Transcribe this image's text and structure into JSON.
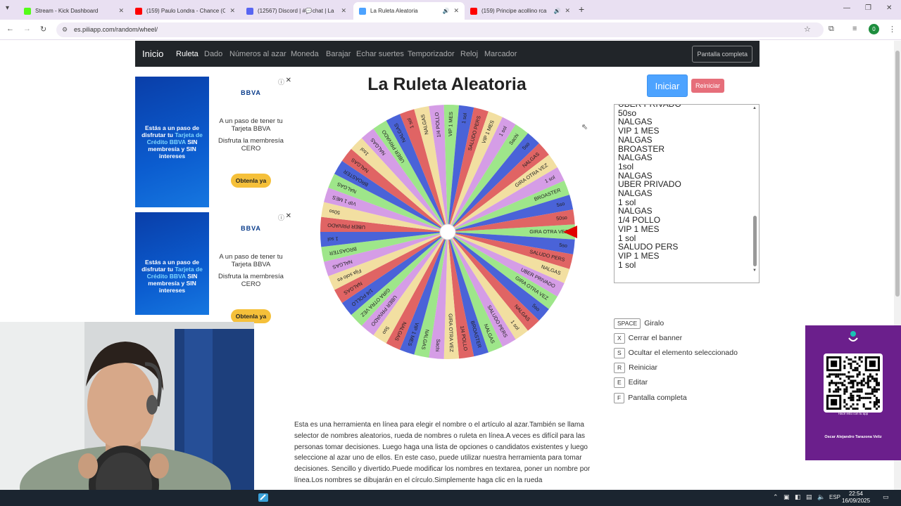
{
  "browser": {
    "tabs": [
      {
        "title": "Stream - Kick Dashboard",
        "favicon_color": "#53fc18",
        "active": false
      },
      {
        "title": "(159) Paulo Londra - Chance (O",
        "favicon_color": "#ff0000",
        "active": false
      },
      {
        "title": "(12567) Discord | #💬chat | La",
        "favicon_color": "#5865f2",
        "active": false
      },
      {
        "title": "La Ruleta Aleatoria",
        "favicon_color": "#4da3ff",
        "active": true
      },
      {
        "title": "(159) Principe acollino rca",
        "favicon_color": "#ff0000",
        "active": false
      }
    ],
    "url": "es.piliapp.com/random/wheel/",
    "profile_initial": "0"
  },
  "sitenav": {
    "brand": "Inicio",
    "links": [
      "Ruleta",
      "Dado",
      "Números al azar",
      "Moneda",
      "Barajar",
      "Echar suertes",
      "Temporizador",
      "Reloj",
      "Marcador"
    ],
    "fullscreen_label": "Pantalla completa"
  },
  "ads": [
    {
      "headline_a": "Estás a un paso de disfrutar tu ",
      "headline_hl": "Tarjeta de Crédito BBVA",
      "headline_b": " SIN membresía y SIN intereses",
      "brand": "BBVA",
      "body": "A un paso de tener tu Tarjeta BBVA",
      "body2": "Disfruta la membresía CERO",
      "cta": "Obtenla ya"
    },
    {
      "headline_a": "Estás a un paso de disfrutar tu ",
      "headline_hl": "Tarjeta de Crédito BBVA",
      "headline_b": " SIN membresía y SIN intereses",
      "brand": "BBVA",
      "body": "A un paso de tener tu Tarjeta BBVA",
      "body2": "Disfruta la membresía CERO",
      "cta": "Obtenla ya"
    }
  ],
  "main": {
    "title": "La Ruleta Aleatoria",
    "start_label": "Iniciar",
    "reset_label": "Reiniciar"
  },
  "wheel": {
    "colors": [
      "#9ee68a",
      "#4a63d8",
      "#e06464",
      "#f2dfa1",
      "#d59de6"
    ],
    "pointer_color": "#e00000",
    "segments": [
      "GIRA OTRA VEZ",
      "5so",
      "SALUDO PERS",
      "NALGAS",
      "UBER PRIVADO",
      "GIRA OTRA VEZ",
      "5so",
      "NALGAS",
      "1 sol",
      "SALUDO PERS",
      "NALGAS",
      "BROASTER",
      "1/4 POLLO",
      "GIRA OTRA VEZ",
      "Sachi",
      "NALGAS",
      "VIP 1 MES",
      "NALGAS",
      "5so",
      "UBER PRIVADO",
      "GIRA OTRA VEZ",
      "1/4 POLLO",
      "NALGAS",
      "Fija solo es",
      "NALGAS",
      "BROASTER",
      "1 sol",
      "UBER PRIVADO",
      "50so",
      "VIP 1 MES",
      "NALGAS",
      "BROASTER",
      "NALGAS",
      "1sol",
      "NALGAS",
      "UBER PRIVADO",
      "NALGAS",
      "1 sol",
      "NALGAS",
      "1/4 POLLO",
      "VIP 1 MES",
      "1 sol",
      "SALUDO PERS",
      "VIP 1 MES",
      "1 sol",
      "Sachi",
      "5so",
      "NALGAS",
      "GIRA OTRA VEZ",
      "1 sol",
      "BROASTER",
      "5so",
      "50so"
    ]
  },
  "names_list": [
    "UBER PRIVADO",
    "50so",
    "NALGAS",
    "VIP 1 MES",
    "NALGAS",
    "BROASTER",
    "NALGAS",
    "1sol",
    "NALGAS",
    "UBER PRIVADO",
    "NALGAS",
    "1 sol",
    "NALGAS",
    "1/4 POLLO",
    "VIP 1 MES",
    "1 sol",
    "SALUDO PERS",
    "VIP 1 MES",
    "1 sol"
  ],
  "shortcuts": [
    {
      "key": "SPACE",
      "label": "Giralo"
    },
    {
      "key": "X",
      "label": "Cerrar el banner"
    },
    {
      "key": "S",
      "label": "Ocultar el elemento seleccionado"
    },
    {
      "key": "R",
      "label": "Reiniciar"
    },
    {
      "key": "E",
      "label": "Editar"
    },
    {
      "key": "F",
      "label": "Pantalla completa"
    }
  ],
  "description": "Esta es una herramienta en línea para elegir el nombre o el artículo al azar.También se llama selector de nombres aleatorios, rueda de nombres o ruleta en línea.A veces es difícil para las personas tomar decisiones. Luego haga una lista de opciones o candidatos existentes y luego seleccione al azar uno de ellos. En este caso, puede utilizar nuestra herramienta para tomar decisiones. Sencillo y divertido.Puede modificar los nombres en textarea, poner un nombre por línea.Los nombres se dibujarán en el círculo.Simplemente haga clic en la rueda",
  "qr_overlay": {
    "hint": "Hacé esto con tu app",
    "name": "Oscar Alejandro Tarazona Veliz"
  },
  "taskbar": {
    "lang": "ESP",
    "time": "22:54",
    "date": "16/09/2025"
  }
}
